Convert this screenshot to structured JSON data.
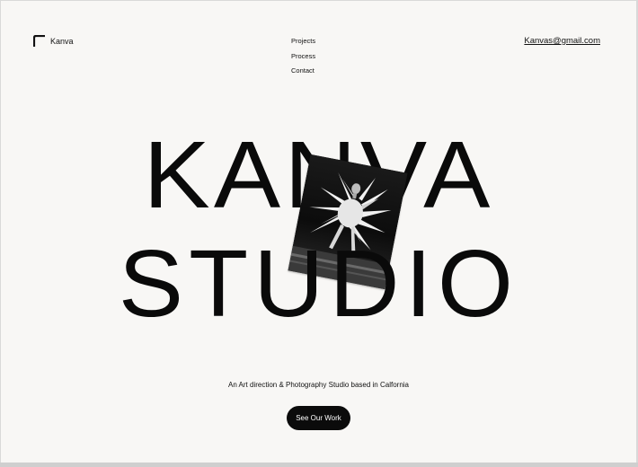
{
  "brand": {
    "logo_text": "Kanva",
    "logo_icon": "corner-bracket-icon"
  },
  "nav": {
    "items": [
      {
        "label": "Projects"
      },
      {
        "label": "Process"
      },
      {
        "label": "Contact"
      }
    ]
  },
  "header": {
    "email": "Kanvas@gmail.com"
  },
  "hero": {
    "line1": "KANVA",
    "line2": "STUDIO",
    "photo_icon": "fashion-photo"
  },
  "tagline": "An Art direction & Photography Studio based in Calfornia",
  "cta": {
    "label": "See Our Work"
  },
  "colors": {
    "background": "#f8f7f5",
    "text": "#0a0a0a",
    "button": "#0b0b0b"
  }
}
